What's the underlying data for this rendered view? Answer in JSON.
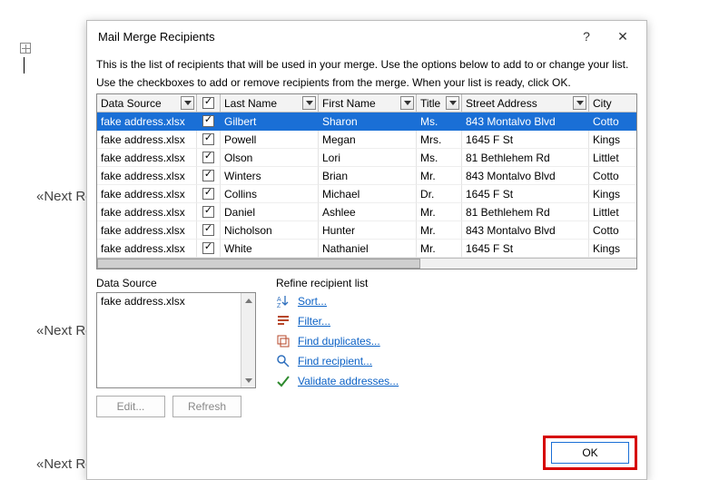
{
  "background": {
    "next_record": "«Next Record»"
  },
  "dialog": {
    "title": "Mail Merge Recipients",
    "help_glyph": "?",
    "close_glyph": "✕",
    "instructions_line1": "This is the list of recipients that will be used in your merge.  Use the options below to add to or change your list.",
    "instructions_line2": "Use the checkboxes to add or remove recipients from the merge.  When your list is ready, click OK.",
    "columns": {
      "data_source": "Data Source",
      "last_name": "Last Name",
      "first_name": "First Name",
      "title": "Title",
      "street_address": "Street Address",
      "city": "City"
    },
    "rows": [
      {
        "ds": "fake address.xlsx",
        "ln": "Gilbert",
        "fn": "Sharon",
        "ti": "Ms.",
        "ad": "843 Montalvo Blvd",
        "ci": "Cotto",
        "selected": true
      },
      {
        "ds": "fake address.xlsx",
        "ln": "Powell",
        "fn": "Megan",
        "ti": "Mrs.",
        "ad": "1645 F St",
        "ci": "Kings",
        "selected": false
      },
      {
        "ds": "fake address.xlsx",
        "ln": "Olson",
        "fn": "Lori",
        "ti": "Ms.",
        "ad": "81 Bethlehem Rd",
        "ci": "Littlet",
        "selected": false
      },
      {
        "ds": "fake address.xlsx",
        "ln": "Winters",
        "fn": "Brian",
        "ti": "Mr.",
        "ad": "843 Montalvo Blvd",
        "ci": "Cotto",
        "selected": false
      },
      {
        "ds": "fake address.xlsx",
        "ln": "Collins",
        "fn": "Michael",
        "ti": "Dr.",
        "ad": "1645 F St",
        "ci": "Kings",
        "selected": false
      },
      {
        "ds": "fake address.xlsx",
        "ln": "Daniel",
        "fn": "Ashlee",
        "ti": "Mr.",
        "ad": "81 Bethlehem Rd",
        "ci": "Littlet",
        "selected": false
      },
      {
        "ds": "fake address.xlsx",
        "ln": "Nicholson",
        "fn": "Hunter",
        "ti": "Mr.",
        "ad": "843 Montalvo Blvd",
        "ci": "Cotto",
        "selected": false
      },
      {
        "ds": "fake address.xlsx",
        "ln": "White",
        "fn": "Nathaniel",
        "ti": "Mr.",
        "ad": "1645 F St",
        "ci": "Kings",
        "selected": false
      }
    ],
    "data_source_label": "Data Source",
    "data_sources": [
      "fake address.xlsx"
    ],
    "edit_button": "Edit...",
    "refresh_button": "Refresh",
    "refine_label": "Refine recipient list",
    "refine": {
      "sort": "Sort...",
      "filter": "Filter...",
      "find_duplicates": "Find duplicates...",
      "find_recipient": "Find recipient...",
      "validate": "Validate addresses..."
    },
    "ok_button": "OK"
  }
}
